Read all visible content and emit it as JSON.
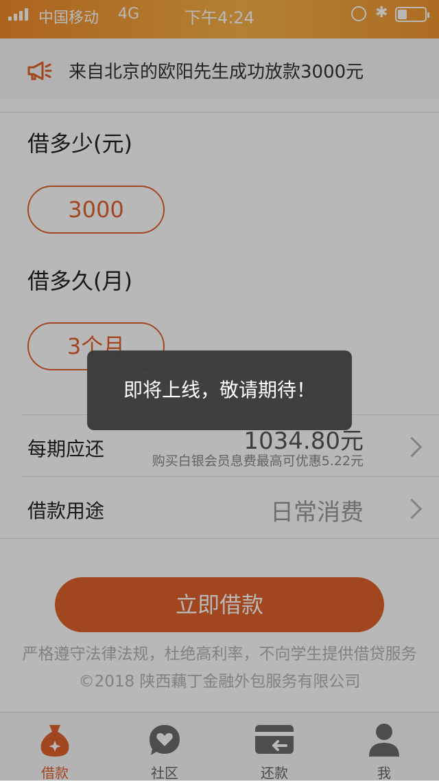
{
  "status_bar": {
    "carrier": "中国移动",
    "network": "4G",
    "time": "下午4:24",
    "battery_level": 0.35
  },
  "notice": {
    "text": "来自北京的欧阳先生成功放款3000元",
    "icon": "megaphone-icon"
  },
  "loan": {
    "amount_label": "借多少(元)",
    "amount_value": "3000",
    "term_label": "借多久(月)",
    "term_value": "3个月"
  },
  "repayment": {
    "label": "每期应还",
    "value": "1034.80元",
    "note": "购买白银会员息费最高可优惠5.22元"
  },
  "purpose": {
    "label": "借款用途",
    "value": "日常消费"
  },
  "cta": {
    "label": "立即借款"
  },
  "footer": {
    "line1": "严格遵守法律法规，杜绝高利率，不向学生提供借贷服务",
    "line2": "©2018 陕西藕丁金融外包服务有限公司"
  },
  "tabs": [
    {
      "label": "借款",
      "icon": "money-bag-icon",
      "active": true
    },
    {
      "label": "社区",
      "icon": "heart-chat-icon",
      "active": false
    },
    {
      "label": "还款",
      "icon": "wallet-card-icon",
      "active": false
    },
    {
      "label": "我",
      "icon": "person-icon",
      "active": false
    }
  ],
  "toast": {
    "text": "即将上线，敬请期待！"
  },
  "colors": {
    "accent": "#e0612c",
    "status_bar": "#f5a33c"
  }
}
